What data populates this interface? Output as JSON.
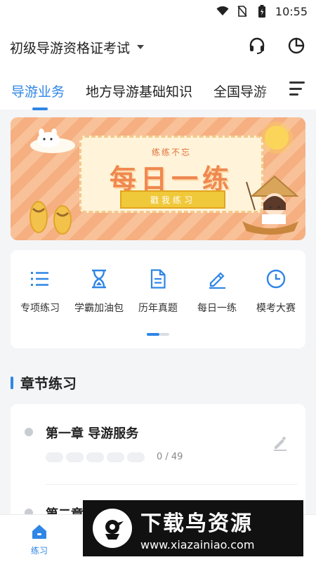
{
  "status_bar": {
    "time": "10:55",
    "icons": [
      "wifi-icon",
      "no-sim-icon",
      "battery-icon"
    ]
  },
  "header": {
    "exam_title": "初级导游资格证考试",
    "actions": [
      "headset-icon",
      "pie-chart-icon"
    ]
  },
  "tabs": [
    {
      "label": "导游业务",
      "active": true
    },
    {
      "label": "地方导游基础知识",
      "active": false
    },
    {
      "label": "全国导游",
      "active": false
    }
  ],
  "banner": {
    "subtitle": "练练不忘",
    "headline": "每日一练",
    "button_label": "戳我练习"
  },
  "features": [
    {
      "label": "专项练习",
      "icon": "list-icon"
    },
    {
      "label": "学霸加油包",
      "icon": "hourglass-icon"
    },
    {
      "label": "历年真题",
      "icon": "document-icon"
    },
    {
      "label": "每日一练",
      "icon": "pencil-icon"
    },
    {
      "label": "模考大赛",
      "icon": "clock-icon"
    }
  ],
  "section": {
    "title": "章节练习"
  },
  "chapters": [
    {
      "name": "第一章 导游服务",
      "progress_text": "0 / 49"
    },
    {
      "name": "第二章",
      "progress_text": ""
    }
  ],
  "bottom_nav": [
    {
      "label": "练习",
      "icon": "home-icon",
      "active": true
    }
  ],
  "watermark": {
    "title": "下载鸟资源",
    "url": "www.xiazainiao.com"
  },
  "colors": {
    "accent": "#2f86e6",
    "banner": "#f7b98c",
    "background": "#f4f5f7"
  }
}
